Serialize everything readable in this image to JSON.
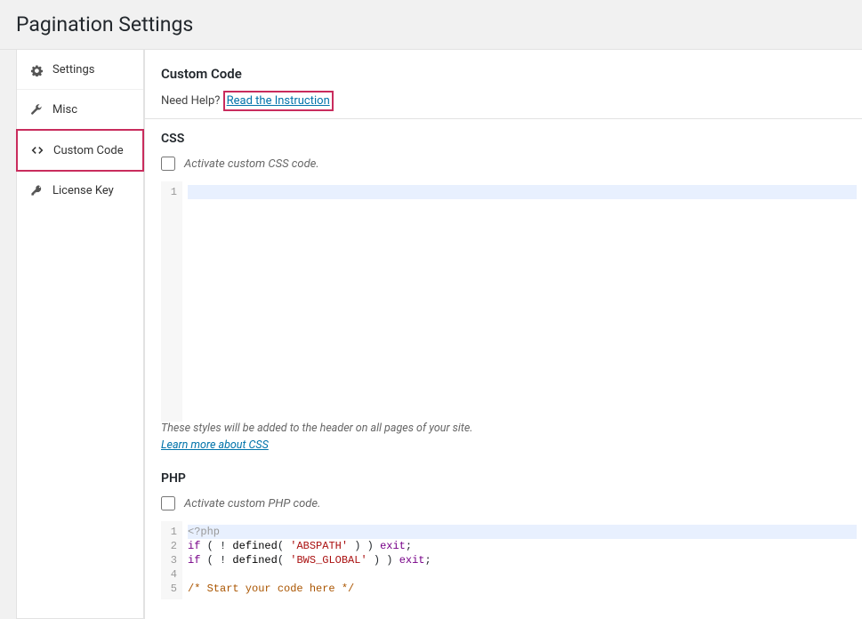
{
  "page": {
    "title": "Pagination Settings"
  },
  "sidebar": {
    "items": [
      {
        "label": "Settings"
      },
      {
        "label": "Misc"
      },
      {
        "label": "Custom Code"
      },
      {
        "label": "License Key"
      }
    ]
  },
  "main": {
    "section_title": "Custom Code",
    "help_prefix": "Need Help?",
    "help_link": "Read the Instruction",
    "css": {
      "title": "CSS",
      "checkbox_label": "Activate custom CSS code.",
      "line_numbers": [
        "1"
      ],
      "helper_text": "These styles will be added to the header on all pages of your site.",
      "learn_more": "Learn more about CSS"
    },
    "php": {
      "title": "PHP",
      "checkbox_label": "Activate custom PHP code.",
      "lines": [
        {
          "n": "1",
          "type": "phptag",
          "text": "<?php"
        },
        {
          "n": "2",
          "type": "code",
          "kw1": "if",
          "paren": " ( ! ",
          "fn": "defined",
          "paren2": "( ",
          "str": "'ABSPATH'",
          "paren3": " ) ) ",
          "kw2": "exit",
          "end": ";"
        },
        {
          "n": "3",
          "type": "code",
          "kw1": "if",
          "paren": " ( ! ",
          "fn": "defined",
          "paren2": "( ",
          "str": "'BWS_GLOBAL'",
          "paren3": " ) ) ",
          "kw2": "exit",
          "end": ";"
        },
        {
          "n": "4",
          "type": "blank",
          "text": ""
        },
        {
          "n": "5",
          "type": "comment",
          "text": "/* Start your code here */"
        }
      ]
    }
  }
}
